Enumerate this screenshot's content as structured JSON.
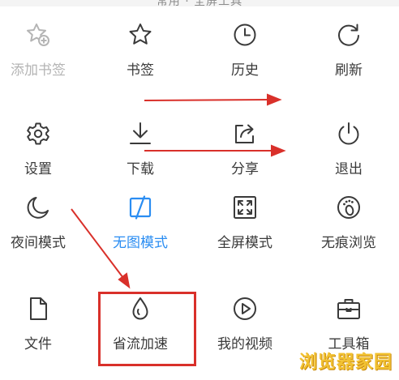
{
  "header": {
    "title_partial": "常用 · 全屏工具"
  },
  "menu": {
    "rows": [
      [
        {
          "label": "添加书签",
          "icon": "star-plus-icon",
          "state": "disabled"
        },
        {
          "label": "书签",
          "icon": "star-icon",
          "state": "normal"
        },
        {
          "label": "历史",
          "icon": "clock-icon",
          "state": "normal"
        },
        {
          "label": "刷新",
          "icon": "refresh-icon",
          "state": "normal"
        }
      ],
      [
        {
          "label": "设置",
          "icon": "gear-icon",
          "state": "normal"
        },
        {
          "label": "下载",
          "icon": "download-icon",
          "state": "normal"
        },
        {
          "label": "分享",
          "icon": "share-icon",
          "state": "normal"
        },
        {
          "label": "退出",
          "icon": "power-icon",
          "state": "normal"
        }
      ],
      [
        {
          "label": "夜间模式",
          "icon": "moon-icon",
          "state": "normal"
        },
        {
          "label": "无图模式",
          "icon": "no-image-icon",
          "state": "active"
        },
        {
          "label": "全屏模式",
          "icon": "fullscreen-icon",
          "state": "normal"
        },
        {
          "label": "无痕浏览",
          "icon": "footprint-icon",
          "state": "normal"
        }
      ],
      [
        {
          "label": "文件",
          "icon": "file-icon",
          "state": "normal"
        },
        {
          "label": "省流加速",
          "icon": "droplet-icon",
          "state": "highlighted"
        },
        {
          "label": "我的视频",
          "icon": "play-circle-icon",
          "state": "normal"
        },
        {
          "label": "工具箱",
          "icon": "toolbox-icon",
          "state": "normal"
        }
      ]
    ]
  },
  "colors": {
    "active": "#2a8df2",
    "disabled": "#b4b4b4",
    "annotation": "#d9302a",
    "icon": "#3a3a3a"
  },
  "watermark": {
    "text": "浏览器家园"
  }
}
